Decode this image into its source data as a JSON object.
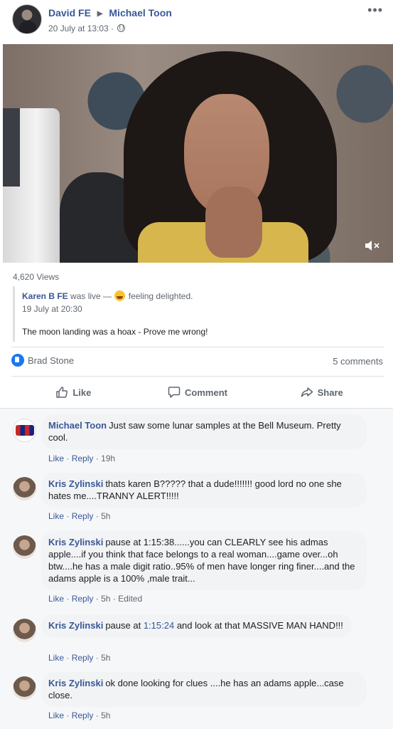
{
  "post": {
    "author": "David FE",
    "target": "Michael Toon",
    "separator": "▶",
    "date": "20 July at 13:03 ·",
    "more": "•••",
    "views": "4,620 Views"
  },
  "shared": {
    "who": "Karen B FE",
    "live_text": "was live —",
    "feeling": "feeling delighted.",
    "time": "19 July at 20:30",
    "text": "The moon landing was a hoax - Prove me wrong!"
  },
  "reactions": {
    "names": "Brad Stone",
    "comments": "5 comments"
  },
  "actions": {
    "like": "Like",
    "comment": "Comment",
    "share": "Share"
  },
  "comments": [
    {
      "author": "Michael Toon",
      "text": "Just saw some lunar samples at the Bell Museum. Pretty cool.",
      "like": "Like",
      "reply": "Reply",
      "time": "19h"
    },
    {
      "author": "Kris Zylinski",
      "text": "thats karen B????? that a dude!!!!!!! good lord no one she hates me....TRANNY ALERT!!!!!",
      "like": "Like",
      "reply": "Reply",
      "time": "5h"
    },
    {
      "author": "Kris Zylinski",
      "text": "pause at 1:15:38......you can CLEARLY see his admas apple....if you think that face belongs to a real woman....game over...oh btw....he has a male digit ratio..95% of men have longer ring finer....and the adams apple is a 100% ,male trait...",
      "like": "Like",
      "reply": "Reply",
      "time": "5h",
      "edited": "Edited"
    },
    {
      "author": "Kris Zylinski",
      "text_before": "pause at",
      "timestamp": "1:15:24",
      "text_after": "and look at that MASSIVE MAN HAND!!!",
      "like": "Like",
      "reply": "Reply",
      "time": "5h"
    },
    {
      "author": "Kris Zylinski",
      "text": "ok done looking for clues ....he has an adams apple...case close.",
      "like": "Like",
      "reply": "Reply",
      "time": "5h"
    }
  ],
  "dot": "·",
  "colors": {
    "link": "#385898",
    "meta": "#606770",
    "like_blue": "#1877f2"
  }
}
